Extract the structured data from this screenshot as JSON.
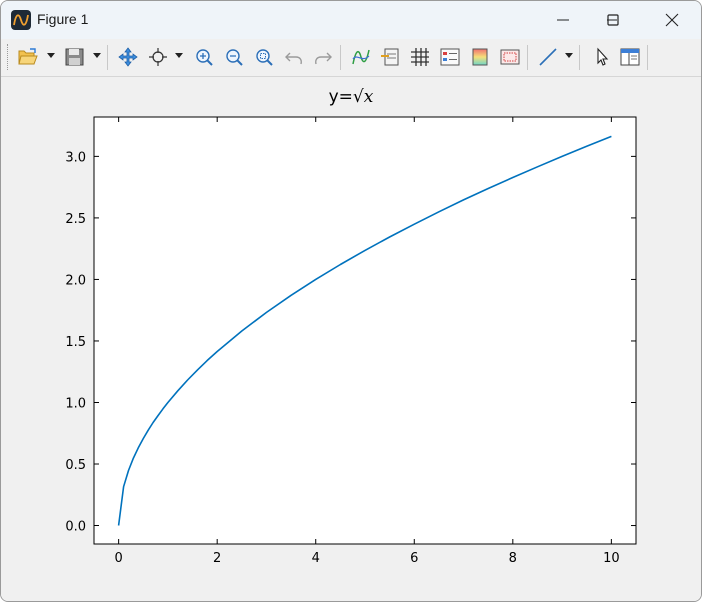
{
  "window": {
    "title": "Figure 1",
    "minimize_icon": "minimize-icon",
    "maximize_icon": "maximize-icon",
    "close_icon": "close-icon"
  },
  "toolbar": {
    "items": [
      {
        "name": "open-button",
        "icon": "folder-open-icon",
        "dropdown": true
      },
      {
        "name": "save-button",
        "icon": "floppy-disk-icon",
        "dropdown": true
      },
      {
        "name": "pan-button",
        "icon": "move-arrows-icon"
      },
      {
        "name": "zoom-mode-button",
        "icon": "crosshair-icon",
        "dropdown": true
      },
      {
        "name": "zoom-in-button",
        "icon": "zoom-in-icon"
      },
      {
        "name": "zoom-out-button",
        "icon": "zoom-out-icon"
      },
      {
        "name": "zoom-fit-button",
        "icon": "zoom-fit-icon"
      },
      {
        "name": "undo-button",
        "icon": "undo-icon"
      },
      {
        "name": "redo-button",
        "icon": "redo-icon"
      },
      {
        "name": "curves-button",
        "icon": "curve-icon"
      },
      {
        "name": "legend-button",
        "icon": "legend-icon"
      },
      {
        "name": "grid-button",
        "icon": "grid-icon"
      },
      {
        "name": "properties-button",
        "icon": "properties-icon"
      },
      {
        "name": "colormap-button",
        "icon": "colormap-icon"
      },
      {
        "name": "axes-frame-button",
        "icon": "frame-icon"
      },
      {
        "name": "line-style-button",
        "icon": "line-icon",
        "dropdown": true
      },
      {
        "name": "select-button",
        "icon": "pointer-icon"
      },
      {
        "name": "panel-button",
        "icon": "panel-icon"
      }
    ]
  },
  "colors": {
    "line": "#0072bd",
    "background": "#f0f0f0",
    "axes": "#ffffff"
  },
  "chart_data": {
    "type": "line",
    "title_prefix": "y=√",
    "title_var": "x",
    "xlabel": "",
    "ylabel": "",
    "xlim": [
      -0.5,
      10.5
    ],
    "ylim": [
      -0.15,
      3.32
    ],
    "xticks": [
      0,
      2,
      4,
      6,
      8,
      10
    ],
    "xtick_labels": [
      "0",
      "2",
      "4",
      "6",
      "8",
      "10"
    ],
    "yticks": [
      0.0,
      0.5,
      1.0,
      1.5,
      2.0,
      2.5,
      3.0
    ],
    "ytick_labels": [
      "0.0",
      "0.5",
      "1.0",
      "1.5",
      "2.0",
      "2.5",
      "3.0"
    ],
    "grid": false,
    "series": [
      {
        "x": [
          0,
          0.1,
          0.2,
          0.3,
          0.4,
          0.5,
          0.6,
          0.7,
          0.8,
          0.9,
          1.0,
          1.2,
          1.4,
          1.6,
          1.8,
          2.0,
          2.5,
          3.0,
          3.5,
          4.0,
          4.5,
          5.0,
          5.5,
          6.0,
          6.5,
          7.0,
          7.5,
          8.0,
          8.5,
          9.0,
          9.5,
          10.0
        ],
        "y": [
          0,
          0.316,
          0.447,
          0.548,
          0.632,
          0.707,
          0.775,
          0.837,
          0.894,
          0.949,
          1.0,
          1.095,
          1.183,
          1.265,
          1.342,
          1.414,
          1.581,
          1.732,
          1.871,
          2.0,
          2.121,
          2.236,
          2.345,
          2.449,
          2.55,
          2.646,
          2.739,
          2.828,
          2.915,
          3.0,
          3.082,
          3.162
        ]
      }
    ]
  }
}
